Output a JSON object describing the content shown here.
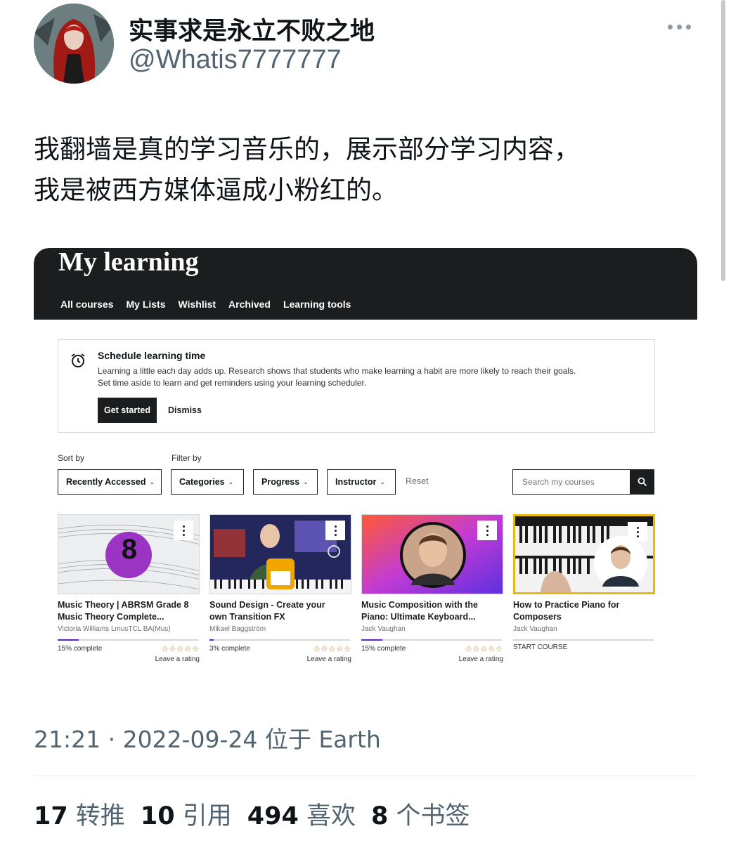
{
  "tweet": {
    "display_name": "实事求是永立不败之地",
    "handle": "@Whatis7777777",
    "text": "我翻墙是真的学习音乐的，展示部分学习内容，\n我是被西方媒体逼成小粉红的。",
    "timestamp": "21:21 · 2022-09-24 位于 Earth",
    "stats": [
      {
        "count": "17",
        "label": "转推"
      },
      {
        "count": "10",
        "label": "引用"
      },
      {
        "count": "494",
        "label": "喜欢"
      },
      {
        "count": "8",
        "label": "个书签"
      }
    ]
  },
  "screenshot": {
    "title": "My learning",
    "tabs": [
      "All courses",
      "My Lists",
      "Wishlist",
      "Archived",
      "Learning tools"
    ],
    "active_tab": "All courses",
    "schedule": {
      "title": "Schedule learning time",
      "body": "Learning a little each day adds up. Research shows that students who make learning a habit are more likely to reach their goals.\nSet time aside to learn and get reminders using your learning scheduler.",
      "start_label": "Get started",
      "dismiss_label": "Dismiss"
    },
    "sort_label": "Sort by",
    "filter_label": "Filter by",
    "sort_value": "Recently Accessed",
    "filters": [
      "Categories",
      "Progress",
      "Instructor"
    ],
    "reset_label": "Reset",
    "search_placeholder": "Search my courses",
    "courses": [
      {
        "title": "Music Theory | ABRSM Grade 8\nMusic Theory Complete...",
        "instructor": "Victoria Williams LmusTCL BA(Mus)",
        "progress_text": "15% complete",
        "progress": 0.15,
        "rating_label": "Leave a rating",
        "stars": "☆☆☆☆☆",
        "thumb_number": "8"
      },
      {
        "title": "Sound Design - Create your\nown Transition FX",
        "instructor": "Mikael Baggström",
        "progress_text": "3% complete",
        "progress": 0.03,
        "rating_label": "Leave a rating",
        "stars": "☆☆☆☆☆"
      },
      {
        "title": "Music Composition with the\nPiano: Ultimate Keyboard...",
        "instructor": "Jack Vaughan",
        "progress_text": "15% complete",
        "progress": 0.15,
        "rating_label": "Leave a rating",
        "stars": "☆☆☆☆☆"
      },
      {
        "title": "How to Practice Piano for\nComposers",
        "instructor": "Jack Vaughan",
        "progress_text": "START COURSE",
        "progress": 0
      }
    ]
  },
  "icons": {
    "more": "more-horizontal-icon",
    "clock": "alarm-clock-icon",
    "search": "search-icon",
    "kebab": "more-vertical-icon"
  },
  "colors": {
    "header_bg": "#1c1d1f",
    "progress": "#5624d0",
    "star": "#b4690e",
    "muted": "#536471"
  }
}
